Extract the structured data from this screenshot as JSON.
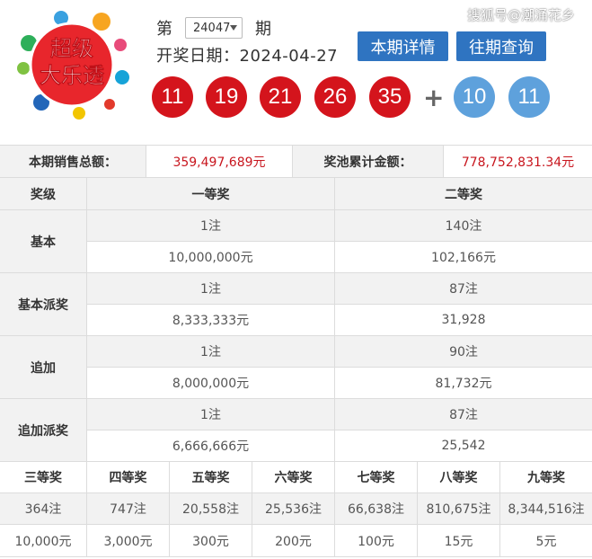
{
  "header": {
    "logo_text_top": "超级",
    "logo_text_bottom": "大乐透",
    "issue_prefix": "第",
    "issue_number": "24047",
    "issue_suffix": "期",
    "draw_date_label": "开奖日期：",
    "draw_date": "2024-04-27",
    "btn_current": "本期详情",
    "btn_history": "往期查询",
    "watermark": "搜狐号@潮涌花乡"
  },
  "balls": {
    "front": [
      "11",
      "19",
      "21",
      "26",
      "35"
    ],
    "plus": "+",
    "back": [
      "10",
      "11"
    ]
  },
  "colors": {
    "red_ball": "#d4141c",
    "blue_ball": "#5ea1dc",
    "button": "#2f74c1",
    "amount_red": "#c8161e"
  },
  "sales": {
    "sales_label": "本期销售总额：",
    "sales_value": "359,497,689元",
    "pool_label": "奖池累计金额：",
    "pool_value": "778,752,831.34元"
  },
  "prize_table": {
    "col_level": "奖级",
    "col_first": "一等奖",
    "col_second": "二等奖",
    "rows": [
      {
        "name": "基本",
        "first_count": "1注",
        "first_amount": "10,000,000元",
        "second_count": "140注",
        "second_amount": "102,166元"
      },
      {
        "name": "基本派奖",
        "first_count": "1注",
        "first_amount": "8,333,333元",
        "second_count": "87注",
        "second_amount": "31,928"
      },
      {
        "name": "追加",
        "first_count": "1注",
        "first_amount": "8,000,000元",
        "second_count": "90注",
        "second_amount": "81,732元"
      },
      {
        "name": "追加派奖",
        "first_count": "1注",
        "first_amount": "6,666,666元",
        "second_count": "87注",
        "second_amount": "25,542"
      }
    ]
  },
  "lower_table": {
    "headers": [
      "三等奖",
      "四等奖",
      "五等奖",
      "六等奖",
      "七等奖",
      "八等奖",
      "九等奖"
    ],
    "counts": [
      "364注",
      "747注",
      "20,558注",
      "25,536注",
      "66,638注",
      "810,675注",
      "8,344,516注"
    ],
    "amounts": [
      "10,000元",
      "3,000元",
      "300元",
      "200元",
      "100元",
      "15元",
      "5元"
    ]
  }
}
